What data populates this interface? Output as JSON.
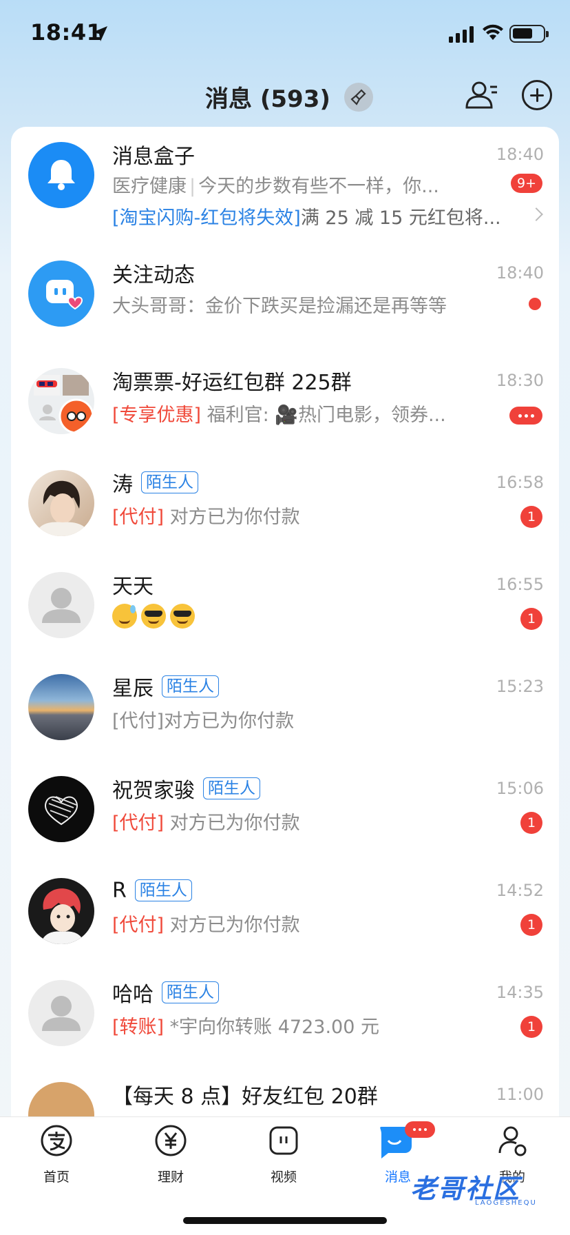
{
  "status_bar": {
    "time": "18:41"
  },
  "header": {
    "title": "消息 (593)"
  },
  "conversations": [
    {
      "name": "消息盒子",
      "time": "18:40",
      "preview_tag": "医疗健康",
      "preview": "今天的步数有些不一样，你...",
      "line2_tag": "[淘宝闪购-红包将失效]",
      "line2": "满 25 减 15 元红包将...",
      "badge": "9+"
    },
    {
      "name": "关注动态",
      "time": "18:40",
      "preview": "大头哥哥：金价下跌买是捡漏还是再等等"
    },
    {
      "name": "淘票票-好运红包群 225群",
      "time": "18:30",
      "preview_tag": "[专享优惠]",
      "preview": "福利官: 🎥热门电影，领券..."
    },
    {
      "name": "涛",
      "tag": "陌生人",
      "time": "16:58",
      "preview_tag": "[代付]",
      "preview": "对方已为你付款",
      "badge": "1"
    },
    {
      "name": "天天",
      "time": "16:55",
      "badge": "1"
    },
    {
      "name": "星辰",
      "tag": "陌生人",
      "time": "15:23",
      "preview": "[代付]对方已为你付款"
    },
    {
      "name": "祝贺家骏",
      "tag": "陌生人",
      "time": "15:06",
      "preview_tag": "[代付]",
      "preview": "对方已为你付款",
      "badge": "1"
    },
    {
      "name": "R",
      "tag": "陌生人",
      "time": "14:52",
      "preview_tag": "[代付]",
      "preview": "对方已为你付款",
      "badge": "1"
    },
    {
      "name": "哈哈",
      "tag": "陌生人",
      "time": "14:35",
      "preview_tag": "[转账]",
      "preview": "*宇向你转账 4723.00 元",
      "badge": "1"
    },
    {
      "name": "【每天 8 点】好友红包 20群",
      "time": "11:00"
    }
  ],
  "tabs": [
    {
      "label": "首页",
      "icon": "alipay-icon"
    },
    {
      "label": "理财",
      "icon": "yuan-icon"
    },
    {
      "label": "视频",
      "icon": "video-icon"
    },
    {
      "label": "消息",
      "icon": "message-icon",
      "active": true
    },
    {
      "label": "我的",
      "icon": "profile-icon"
    }
  ],
  "watermark": {
    "text": "老哥社区",
    "sub": "LAOGESHEQU"
  },
  "colors": {
    "accent": "#1677ff",
    "badge": "#f0413a",
    "link": "#2a82e4",
    "tag_red": "#f0493a"
  }
}
